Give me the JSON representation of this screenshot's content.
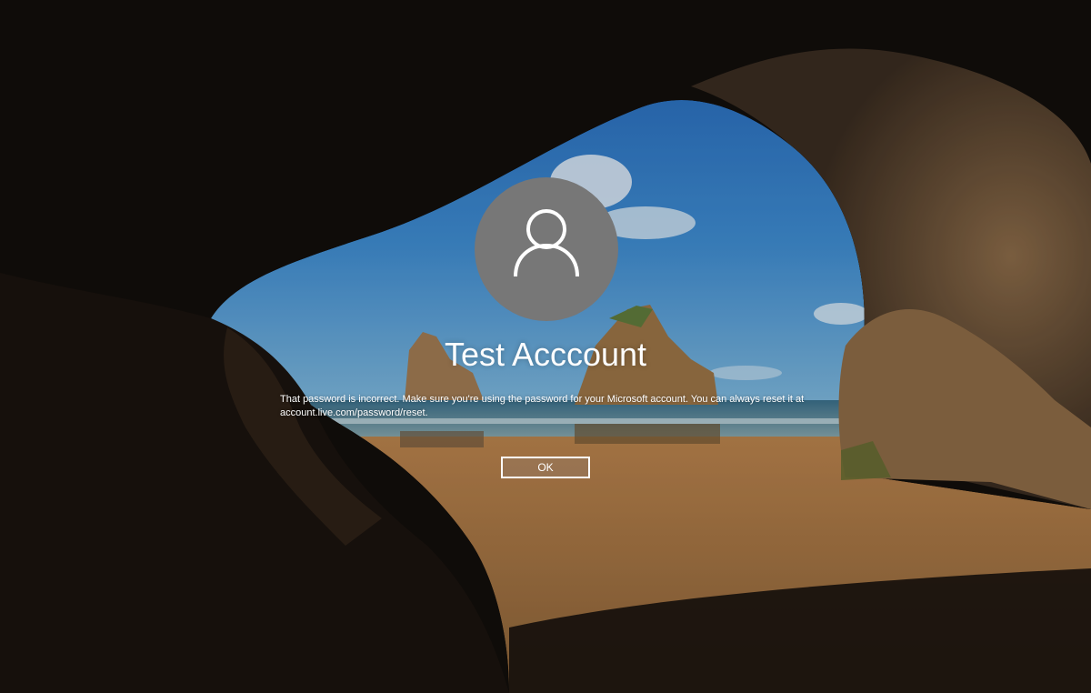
{
  "login": {
    "user_name": "Test Acccount",
    "error_message_line1": "That password is incorrect. Make sure you're using the password for your Microsoft account. You can always reset it at",
    "error_message_line2": "account.live.com/password/reset.",
    "ok_label": "OK"
  },
  "icons": {
    "avatar": "user-icon"
  },
  "colors": {
    "avatar_bg": "#777777",
    "text": "#ffffff",
    "sky": "#2f78c4",
    "sand": "#c28a50"
  }
}
